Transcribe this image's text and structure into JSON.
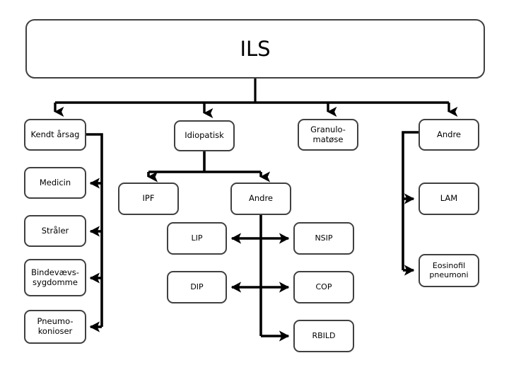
{
  "diagram": {
    "title": "ILS",
    "language": "da",
    "style": {
      "box_border_color": "#404040",
      "box_fill_color": "#ffffff",
      "connector_color": "#000000",
      "text_color": "#000000",
      "page_background": "#ffffff"
    },
    "nodes": {
      "root": {
        "label": "ILS"
      },
      "level1": [
        {
          "id": "kendt-arsag",
          "label": "Kendt årsag"
        },
        {
          "id": "idiopatisk",
          "label": "Idiopatisk"
        },
        {
          "id": "granulomatose",
          "label": "Granulo-\nmatøse"
        },
        {
          "id": "andre-top",
          "label": "Andre"
        }
      ],
      "kendt_arsag_children": [
        {
          "id": "medicin",
          "label": "Medicin"
        },
        {
          "id": "straler",
          "label": "Stråler"
        },
        {
          "id": "bindevaevssygdomme",
          "label": "Bindevævs-\nsygdomme"
        },
        {
          "id": "pneumokonioser",
          "label": "Pneumo-\nkonioser"
        }
      ],
      "idiopatisk_children": [
        {
          "id": "ipf",
          "label": "IPF"
        },
        {
          "id": "andre-idiopatisk",
          "label": "Andre"
        }
      ],
      "andre_idiopatisk_children": [
        {
          "id": "lip",
          "label": "LIP"
        },
        {
          "id": "nsip",
          "label": "NSIP"
        },
        {
          "id": "dip",
          "label": "DIP"
        },
        {
          "id": "cop",
          "label": "COP"
        },
        {
          "id": "rbild",
          "label": "RBILD"
        }
      ],
      "andre_top_children": [
        {
          "id": "lam",
          "label": "LAM"
        },
        {
          "id": "eosinofil-pneumoni",
          "label": "Eosinofil\npneumoni"
        }
      ]
    }
  }
}
